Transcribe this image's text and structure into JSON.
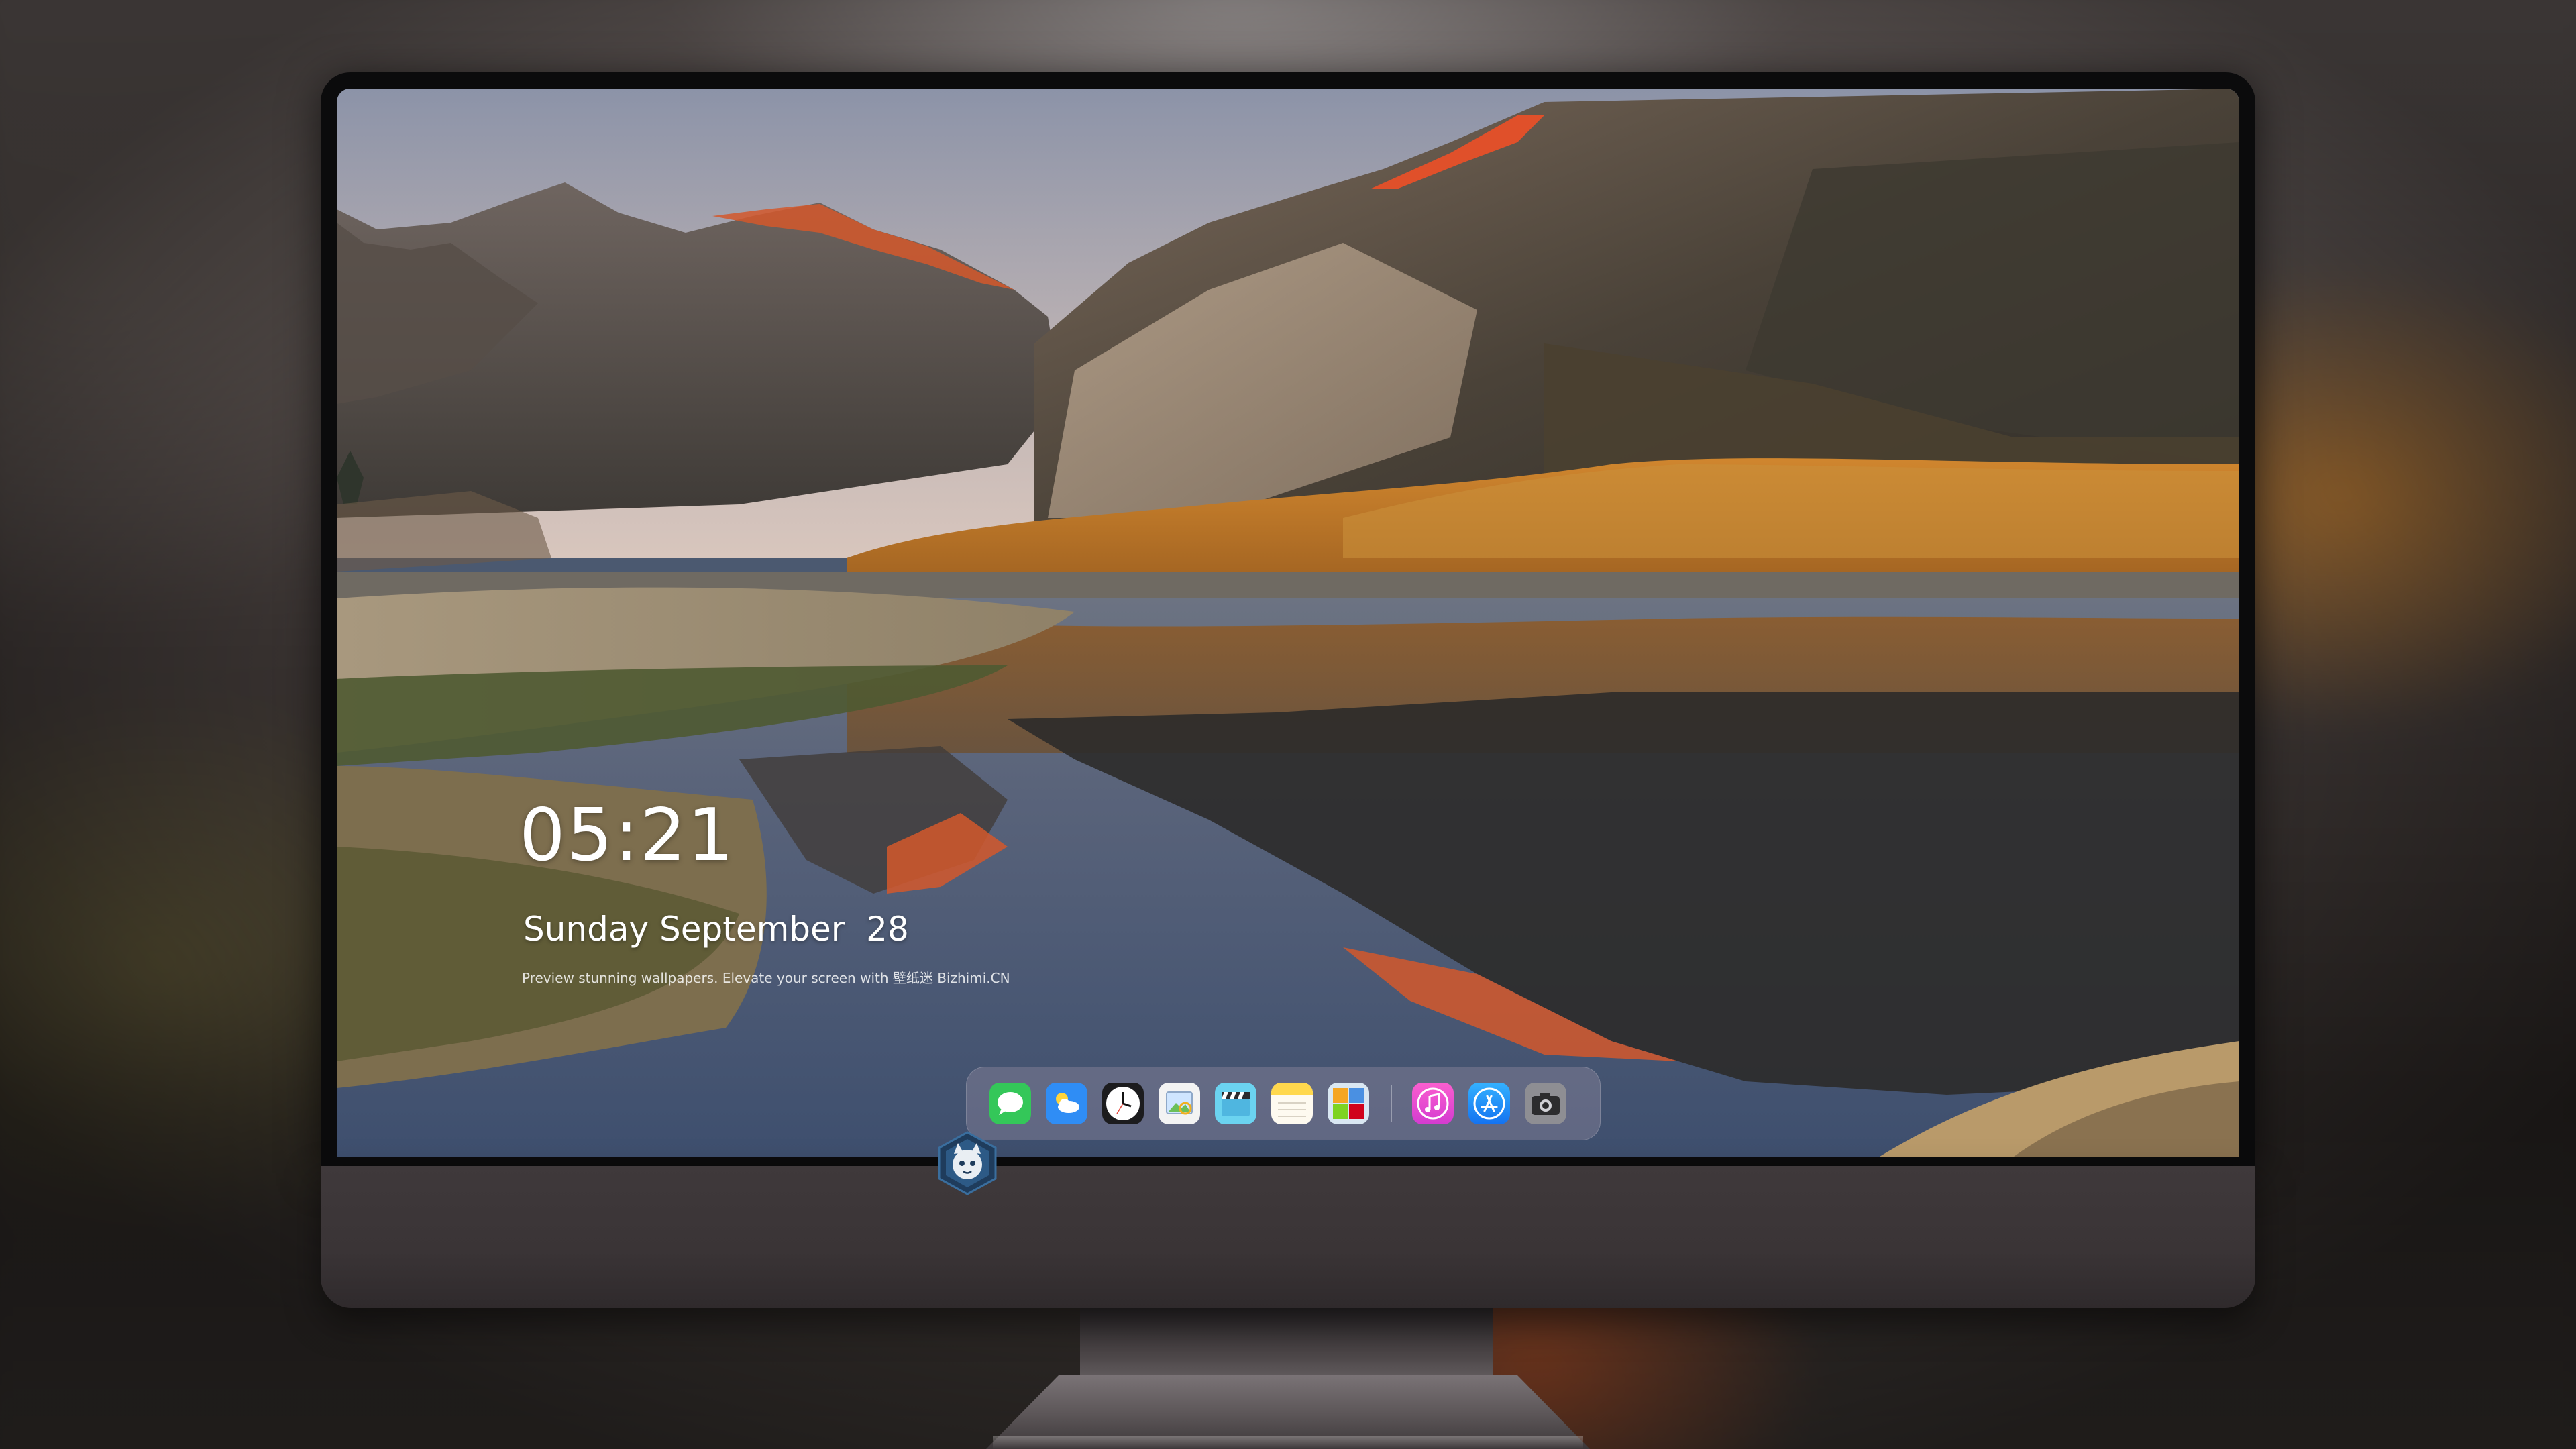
{
  "lockscreen": {
    "time": "05:21",
    "date": "Sunday September  28",
    "tagline": "Preview stunning wallpapers. Elevate your screen with   壁纸迷   Bizhimi.CN"
  },
  "dock": {
    "apps": [
      {
        "name": "messages",
        "icon": "messages-icon",
        "color": "#34c759"
      },
      {
        "name": "weather",
        "icon": "weather-icon",
        "color": "#2f8df5"
      },
      {
        "name": "clock",
        "icon": "clock-icon",
        "color": "#1c1c1e"
      },
      {
        "name": "preview",
        "icon": "preview-icon",
        "color": "#f3f3f3"
      },
      {
        "name": "clips",
        "icon": "clips-icon",
        "color": "#6bd3f0"
      },
      {
        "name": "notes",
        "icon": "notes-icon",
        "color": "#ffd84d"
      },
      {
        "name": "photo-booth",
        "icon": "photo-booth-icon",
        "color": "#d9e7f2"
      },
      {
        "name": "music",
        "icon": "music-icon",
        "color": "#fa57c1"
      },
      {
        "name": "app-store",
        "icon": "app-store-icon",
        "color": "#1e8dfb"
      },
      {
        "name": "camera",
        "icon": "camera-icon",
        "color": "#8e8e93"
      }
    ]
  },
  "monitor": {
    "logo_icon": "mascot-logo-icon"
  }
}
